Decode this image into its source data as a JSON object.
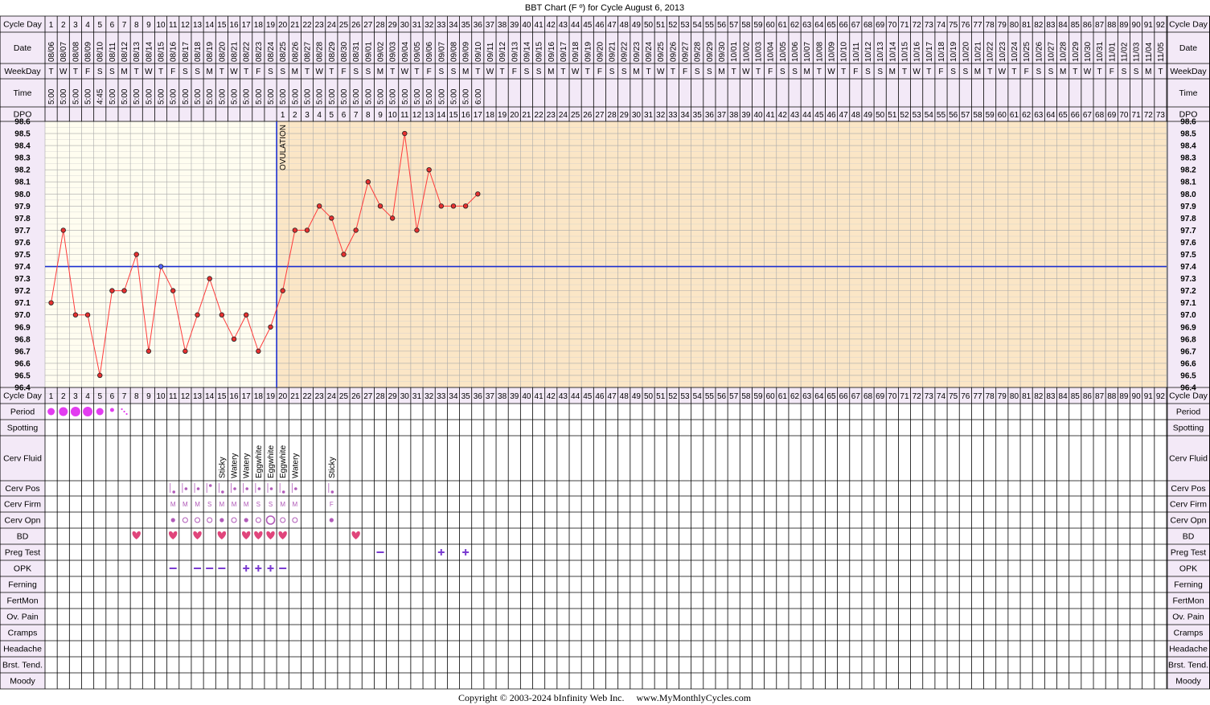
{
  "title": "BBT Chart (F º) for Cycle August 6, 2013",
  "footer": "Copyright © 2003-2024 bInfinity Web Inc.     www.MyMonthlyCycles.com",
  "ovulation_label": "OVULATION",
  "row_labels": {
    "cycle_day": "Cycle Day",
    "date": "Date",
    "weekday": "WeekDay",
    "time": "Time",
    "dpo": "DPO",
    "period": "Period",
    "spotting": "Spotting",
    "cerv_fluid": "Cerv Fluid",
    "cerv_pos": "Cerv Pos",
    "cerv_firm": "Cerv Firm",
    "cerv_opn": "Cerv Opn",
    "bd": "BD",
    "preg_test": "Preg Test",
    "opk": "OPK",
    "ferning": "Ferning",
    "fertmon": "FertMon",
    "ov_pain": "Ov. Pain",
    "cramps": "Cramps",
    "headache": "Headache",
    "brst_tend": "Brst. Tend.",
    "moody": "Moody"
  },
  "colors": {
    "header_bg": "#f3e9f7",
    "pre_ov_bg": "#fffdf0",
    "post_ov_bg": "#fbe6c6",
    "temp_line": "#ff3b3b",
    "coverline": "#1b2fd0",
    "ovulation_line": "#1b2fd0",
    "period_dot": "#e23cf0",
    "heart": "#e0457b",
    "opk_symbol": "#7a3bd0",
    "cervix": "#b05ab8"
  },
  "days": {
    "dates": [
      "08/06",
      "08/07",
      "08/08",
      "08/09",
      "08/10",
      "08/11",
      "08/12",
      "08/13",
      "08/14",
      "08/15",
      "08/16",
      "08/17",
      "08/18",
      "08/19",
      "08/20",
      "08/21",
      "08/22",
      "08/23",
      "08/24",
      "08/25",
      "08/26",
      "08/27",
      "08/28",
      "08/29",
      "08/30",
      "08/31",
      "09/01",
      "09/02",
      "09/03",
      "09/04",
      "09/05",
      "09/06",
      "09/07",
      "09/08",
      "09/09",
      "09/10",
      "09/11",
      "09/12",
      "09/13",
      "09/14",
      "09/15",
      "09/16",
      "09/17",
      "09/18",
      "09/19",
      "09/20",
      "09/21",
      "09/22",
      "09/23",
      "09/24",
      "09/25",
      "09/26",
      "09/27",
      "09/28",
      "09/29",
      "09/30",
      "10/01",
      "10/02",
      "10/03",
      "10/04",
      "10/05",
      "10/06",
      "10/07",
      "10/08",
      "10/09",
      "10/10",
      "10/11",
      "10/12",
      "10/13",
      "10/14",
      "10/15",
      "10/16",
      "10/17",
      "10/18",
      "10/19",
      "10/20",
      "10/21",
      "10/22",
      "10/23",
      "10/24",
      "10/25",
      "10/26",
      "10/27",
      "10/28",
      "10/29",
      "10/30",
      "10/31",
      "11/01",
      "11/02",
      "11/03",
      "11/04",
      "11/05"
    ],
    "weekdays": [
      "T",
      "W",
      "T",
      "F",
      "S",
      "S",
      "M",
      "T",
      "W",
      "T",
      "F",
      "S",
      "S",
      "M",
      "T",
      "W",
      "T",
      "F",
      "S",
      "S",
      "M",
      "T",
      "W",
      "T",
      "F",
      "S",
      "S",
      "M",
      "T",
      "W",
      "T",
      "F",
      "S",
      "S",
      "M",
      "T",
      "W",
      "T",
      "F",
      "S",
      "S",
      "M",
      "T",
      "W",
      "T",
      "F",
      "S",
      "S",
      "M",
      "T",
      "W",
      "T",
      "F",
      "S",
      "S",
      "M",
      "T",
      "W",
      "T",
      "F",
      "S",
      "S",
      "M",
      "T",
      "W",
      "T",
      "F",
      "S",
      "S",
      "M",
      "T",
      "W",
      "T",
      "F",
      "S",
      "S",
      "M",
      "T",
      "W",
      "T",
      "F",
      "S",
      "S",
      "M",
      "T",
      "W",
      "T",
      "F",
      "S",
      "S",
      "M",
      "T"
    ],
    "times": [
      "5:00",
      "5:00",
      "5:00",
      "5:00",
      "4:45",
      "5:00",
      "5:00",
      "5:00",
      "5:00",
      "5:00",
      "5:00",
      "5:00",
      "5:00",
      "5:00",
      "5:00",
      "5:00",
      "5:00",
      "5:00",
      "5:00",
      "5:00",
      "5:00",
      "5:00",
      "5:00",
      "5:00",
      "5:00",
      "5:00",
      "5:00",
      "5:00",
      "5:00",
      "5:00",
      "5:00",
      "5:00",
      "5:00",
      "5:00",
      "5:00",
      "6:00"
    ],
    "dpo_start_day": 20,
    "dpo_max": 73
  },
  "chart_data": {
    "type": "line",
    "x_label": "Cycle Day",
    "x_range": [
      1,
      92
    ],
    "y_range": [
      96.4,
      98.6
    ],
    "y_ticks": [
      "98.6",
      "98.5",
      "98.4",
      "98.3",
      "98.2",
      "98.1",
      "98.0",
      "97.9",
      "97.8",
      "97.7",
      "97.6",
      "97.5",
      "97.4",
      "97.3",
      "97.2",
      "97.1",
      "97.0",
      "96.9",
      "96.8",
      "96.7",
      "96.6",
      "96.5",
      "96.4"
    ],
    "grid": true,
    "coverline": 97.4,
    "ovulation_day": 19,
    "series": [
      {
        "x": [
          1,
          2,
          3,
          4,
          5,
          6,
          7,
          8,
          9,
          10,
          11,
          12,
          13,
          14,
          15,
          16,
          17,
          18,
          19,
          20,
          21,
          22,
          23,
          24,
          25,
          26,
          27,
          28,
          29,
          30,
          31,
          32,
          33,
          34,
          35,
          36
        ],
        "values": [
          97.1,
          97.7,
          97.0,
          97.0,
          96.5,
          97.2,
          97.2,
          97.5,
          96.7,
          97.4,
          97.2,
          96.7,
          97.0,
          97.3,
          97.0,
          96.8,
          97.0,
          96.7,
          96.9,
          97.2,
          97.7,
          97.7,
          97.9,
          97.8,
          97.5,
          97.7,
          98.1,
          97.9,
          97.8,
          98.5,
          97.7,
          98.2,
          97.9,
          97.9,
          97.9,
          98.0
        ]
      }
    ]
  },
  "observations": {
    "period": [
      {
        "day": 1,
        "size": 4.5
      },
      {
        "day": 2,
        "size": 5.5
      },
      {
        "day": 3,
        "size": 6
      },
      {
        "day": 4,
        "size": 6
      },
      {
        "day": 5,
        "size": 4.5
      },
      {
        "day": 6,
        "size": 2.5
      },
      {
        "day": 7,
        "symbol": "spotting"
      }
    ],
    "cerv_fluid": [
      {
        "day": 15,
        "value": "Sticky"
      },
      {
        "day": 16,
        "value": "Watery"
      },
      {
        "day": 17,
        "value": "Watery"
      },
      {
        "day": 18,
        "value": "Eggwhite"
      },
      {
        "day": 19,
        "value": "Eggwhite"
      },
      {
        "day": 20,
        "value": "Eggwhite"
      },
      {
        "day": 21,
        "value": "Watery"
      },
      {
        "day": 24,
        "value": "Sticky"
      }
    ],
    "cerv_pos": [
      {
        "day": 11,
        "level": "low"
      },
      {
        "day": 12,
        "level": "med"
      },
      {
        "day": 13,
        "level": "med"
      },
      {
        "day": 14,
        "level": "high"
      },
      {
        "day": 15,
        "level": "low"
      },
      {
        "day": 16,
        "level": "med"
      },
      {
        "day": 17,
        "level": "med"
      },
      {
        "day": 18,
        "level": "med"
      },
      {
        "day": 19,
        "level": "med"
      },
      {
        "day": 20,
        "level": "low"
      },
      {
        "day": 21,
        "level": "med"
      },
      {
        "day": 24,
        "level": "low"
      }
    ],
    "cerv_firm": [
      {
        "day": 11,
        "value": "M"
      },
      {
        "day": 12,
        "value": "M"
      },
      {
        "day": 13,
        "value": "M"
      },
      {
        "day": 14,
        "value": "S"
      },
      {
        "day": 15,
        "value": "M"
      },
      {
        "day": 16,
        "value": "M"
      },
      {
        "day": 17,
        "value": "M"
      },
      {
        "day": 18,
        "value": "S"
      },
      {
        "day": 19,
        "value": "S"
      },
      {
        "day": 20,
        "value": "M"
      },
      {
        "day": 21,
        "value": "M"
      },
      {
        "day": 24,
        "value": "F"
      }
    ],
    "cerv_opn": [
      {
        "day": 11,
        "value": "closed"
      },
      {
        "day": 12,
        "value": "med"
      },
      {
        "day": 13,
        "value": "med"
      },
      {
        "day": 14,
        "value": "med"
      },
      {
        "day": 15,
        "value": "closed"
      },
      {
        "day": 16,
        "value": "med"
      },
      {
        "day": 17,
        "value": "closed"
      },
      {
        "day": 18,
        "value": "med"
      },
      {
        "day": 19,
        "value": "open"
      },
      {
        "day": 20,
        "value": "med"
      },
      {
        "day": 21,
        "value": "med"
      },
      {
        "day": 24,
        "value": "closed"
      }
    ],
    "bd_days": [
      8,
      11,
      13,
      15,
      17,
      18,
      19,
      20,
      26
    ],
    "preg_test": [
      {
        "day": 28,
        "symbol": "–"
      },
      {
        "day": 33,
        "symbol": "+"
      },
      {
        "day": 35,
        "symbol": "+"
      }
    ],
    "opk": [
      {
        "day": 11,
        "symbol": "–"
      },
      {
        "day": 13,
        "symbol": "–"
      },
      {
        "day": 14,
        "symbol": "–"
      },
      {
        "day": 15,
        "symbol": "–"
      },
      {
        "day": 17,
        "symbol": "+"
      },
      {
        "day": 18,
        "symbol": "+"
      },
      {
        "day": 19,
        "symbol": "+"
      },
      {
        "day": 20,
        "symbol": "–"
      }
    ]
  }
}
